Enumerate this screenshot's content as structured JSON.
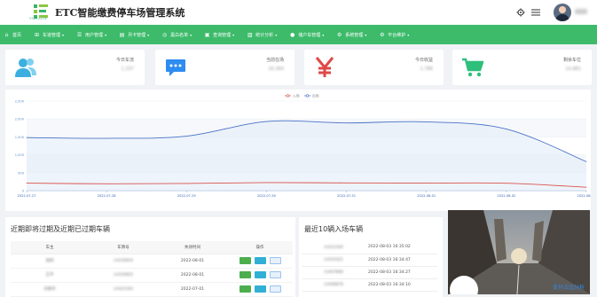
{
  "header": {
    "title": "ETC智能缴费停车场管理系统",
    "logo_subtext": "YSECALUE",
    "user_name": "admin"
  },
  "nav": [
    {
      "label": "首页",
      "icon": "home-icon",
      "dropdown": false
    },
    {
      "label": "车道管理",
      "icon": "road-icon",
      "dropdown": true
    },
    {
      "label": "用户管理",
      "icon": "user-icon",
      "dropdown": true
    },
    {
      "label": "月卡管理",
      "icon": "card-icon",
      "dropdown": true
    },
    {
      "label": "黑白名单",
      "icon": "list-icon",
      "dropdown": true
    },
    {
      "label": "查询管理",
      "icon": "search-icon",
      "dropdown": true
    },
    {
      "label": "统计分析",
      "icon": "chart-icon",
      "dropdown": true
    },
    {
      "label": "储户车管理",
      "icon": "person-icon",
      "dropdown": true
    },
    {
      "label": "系统管理",
      "icon": "settings-icon",
      "dropdown": true
    },
    {
      "label": "平台维护",
      "icon": "gear-icon",
      "dropdown": true
    }
  ],
  "stats": [
    {
      "label": "今日车流",
      "value": "1,337",
      "icon": "users-icon",
      "color": "#3bb0e0"
    },
    {
      "label": "当前在场",
      "value": "16,364",
      "icon": "chat-icon",
      "color": "#2d8cf0"
    },
    {
      "label": "今日收益",
      "value": "1,786",
      "icon": "yen-icon",
      "color": "#e04848"
    },
    {
      "label": "剩余车位",
      "value": "14,881",
      "icon": "cart-icon",
      "color": "#2ebf7a"
    }
  ],
  "chart_data": {
    "type": "line",
    "legend": [
      "入场",
      "出场"
    ],
    "x": [
      "2022-07-27",
      "2022-07-28",
      "2022-07-29",
      "2022-07-30",
      "2022-07-31",
      "2022-08-01",
      "2022-08-02",
      "2022-08-03"
    ],
    "yticks": [
      "2,500",
      "2,000",
      "1,500",
      "1,000",
      "500",
      "0"
    ],
    "ylim": [
      0,
      2500
    ],
    "series": [
      {
        "name": "出场",
        "color": "#4a72c8",
        "values": [
          1480,
          1460,
          1520,
          1930,
          1890,
          1920,
          1720,
          810
        ]
      },
      {
        "name": "入场",
        "color": "#d9534f",
        "values": [
          210,
          190,
          200,
          225,
          215,
          210,
          205,
          95
        ]
      }
    ],
    "grid": true
  },
  "expiry_panel": {
    "title": "近期即将过期及近期已过期车辆",
    "headers": [
      "车主",
      "车牌号",
      "失效时间",
      "操作"
    ],
    "rows": [
      {
        "owner": "张四",
        "plate": "川A35824",
        "date": "2022-08-01"
      },
      {
        "owner": "王平",
        "plate": "川A35855",
        "date": "2022-08-01"
      },
      {
        "owner": "刘春华",
        "plate": "川A22183",
        "date": "2022-07-01"
      }
    ]
  },
  "entry_panel": {
    "title": "最近10辆入场车辆",
    "rows": [
      {
        "plate": "川A12345",
        "time": "2022-08-03 16:35:02"
      },
      {
        "plate": "川A54321",
        "time": "2022-08-03 16:34:47"
      },
      {
        "plate": "川A67890",
        "time": "2022-08-03 16:34:27"
      },
      {
        "plate": "川A09876",
        "time": "2022-08-03 16:34:10"
      }
    ]
  },
  "image_panel": {
    "caption": "支付占比分析",
    "small_label": "Parking"
  }
}
